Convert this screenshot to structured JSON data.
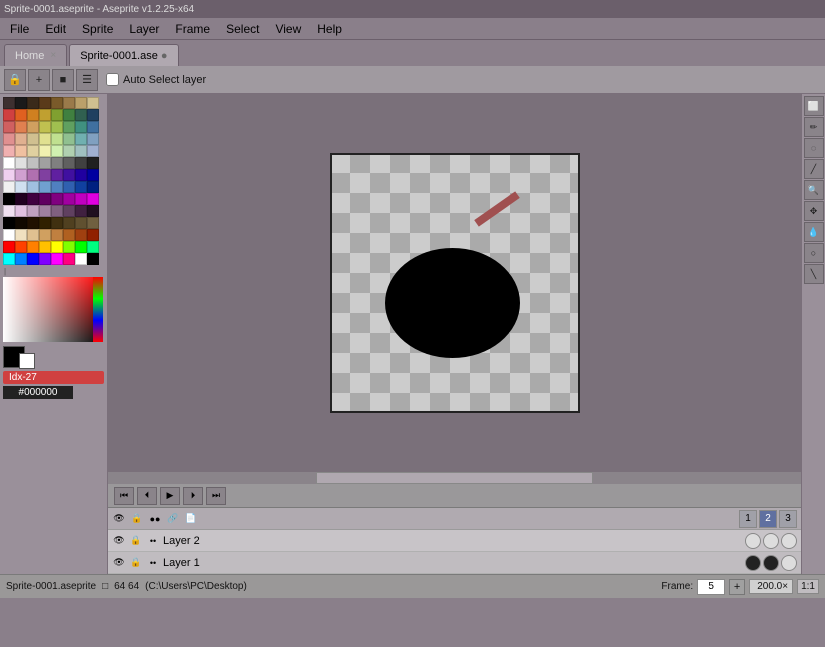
{
  "title_bar": {
    "text": "Sprite-0001.aseprite - Aseprite v1.2.25-x64"
  },
  "menu": {
    "items": [
      "File",
      "Edit",
      "Sprite",
      "Layer",
      "Frame",
      "Select",
      "View",
      "Help"
    ]
  },
  "tabs": [
    {
      "label": "Home",
      "active": false,
      "closeable": true
    },
    {
      "label": "Sprite-0001.ase",
      "active": true,
      "closeable": false,
      "modified": true
    }
  ],
  "toolbar": {
    "lock_label": "🔒",
    "add_label": "+",
    "square_label": "■",
    "menu_label": "☰",
    "auto_select_label": "Auto Select layer"
  },
  "palette": {
    "colors": [
      "#3d3030",
      "#1a1a1a",
      "#3a2a1a",
      "#5a3a1a",
      "#7a5a2a",
      "#9a7a4a",
      "#baa06a",
      "#d0c090",
      "#d04040",
      "#e06020",
      "#d08020",
      "#c0a030",
      "#80a030",
      "#408040",
      "#306050",
      "#204060",
      "#d06060",
      "#e08050",
      "#d0a060",
      "#c0c050",
      "#a0c050",
      "#60a060",
      "#409080",
      "#4070a0",
      "#e09090",
      "#e0b090",
      "#d0c090",
      "#e0e090",
      "#c0e090",
      "#90c090",
      "#70b0b0",
      "#80a0c0",
      "#f0b0b0",
      "#f0c0a0",
      "#e0d0a0",
      "#f0f0b0",
      "#d0f0b0",
      "#b0d0b0",
      "#a0c0c0",
      "#a0b0d0",
      "#ffffff",
      "#e0e0e0",
      "#c0c0c0",
      "#a0a0a0",
      "#808080",
      "#606060",
      "#404040",
      "#202020",
      "#f0d0f0",
      "#d0a0d0",
      "#b070b0",
      "#8040a0",
      "#6020a0",
      "#4010a0",
      "#2000a0",
      "#0000a0",
      "#f0f0f0",
      "#d0e0f0",
      "#a0c0e0",
      "#70a0d0",
      "#5080c0",
      "#3060b0",
      "#1040a0",
      "#002080",
      "#000000",
      "#200020",
      "#400040",
      "#600060",
      "#800080",
      "#a000a0",
      "#c000c0",
      "#e000e0",
      "#f0e0f0",
      "#e0c0e0",
      "#c0a0c0",
      "#a080a0",
      "#806080",
      "#604060",
      "#402040",
      "#201020",
      "#000000",
      "#100800",
      "#201000",
      "#302000",
      "#403010",
      "#504020",
      "#605030",
      "#706040",
      "#ffffff",
      "#f0e0c0",
      "#e0c090",
      "#d0a060",
      "#c08040",
      "#b06020",
      "#a04010",
      "#902000",
      "#ff0000",
      "#ff4000",
      "#ff8000",
      "#ffc000",
      "#ffff00",
      "#80ff00",
      "#00ff00",
      "#00ff80",
      "#00ffff",
      "#0080ff",
      "#0000ff",
      "#8000ff",
      "#ff00ff",
      "#ff0080",
      "#ffffff",
      "#000000"
    ]
  },
  "color_state": {
    "idx_label": "Idx-27",
    "hex_value": "#000000"
  },
  "canvas": {
    "width": 64,
    "height": 64
  },
  "right_tools": [
    "⬜",
    "✏️",
    "○",
    "✏",
    "🔍",
    "✥",
    "💧",
    "◯",
    "✏"
  ],
  "animation": {
    "buttons": [
      "⏮",
      "⏴",
      "▶",
      "⏵",
      "⏭"
    ]
  },
  "layers": {
    "header_icons": [
      "👁",
      "🔒",
      "●●",
      "📋",
      "📄"
    ],
    "frame_numbers": [
      "1",
      "2",
      "3"
    ],
    "rows": [
      {
        "visible": true,
        "locked": true,
        "name": "Layer 2",
        "frames": [
          "empty",
          "empty",
          "empty"
        ]
      },
      {
        "visible": true,
        "locked": true,
        "name": "Layer 1",
        "frames": [
          "filled",
          "filled",
          "empty"
        ]
      }
    ]
  },
  "status_bar": {
    "sprite_name": "Sprite-0001.aseprite",
    "canvas_icon": "□",
    "canvas_size": "64 64",
    "path": "(C:\\Users\\PC\\Desktop)",
    "frame_label": "Frame:",
    "frame_value": "5",
    "zoom_value": "200.0×",
    "ratio_label": "1:1"
  }
}
